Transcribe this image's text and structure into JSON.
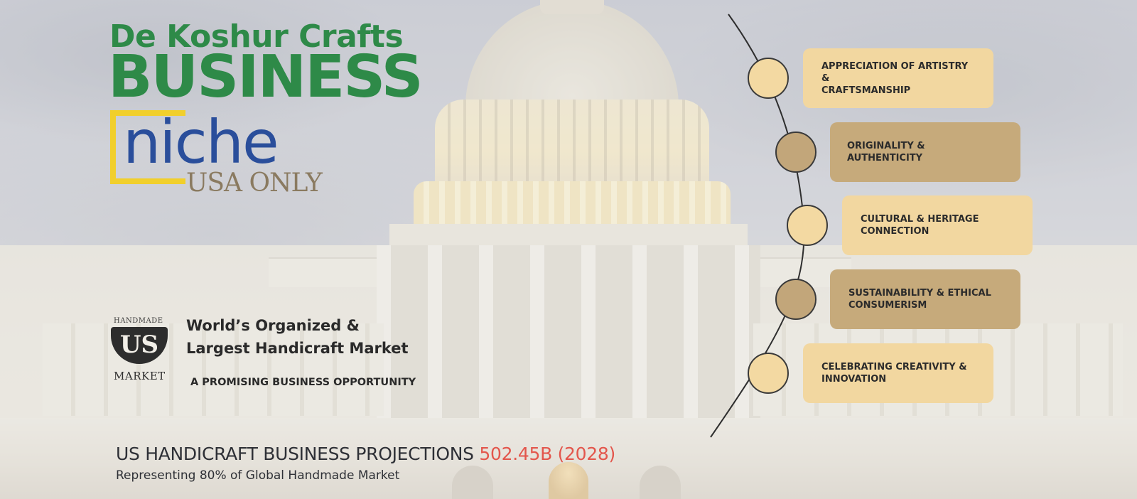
{
  "title": {
    "line1": "De Koshur Crafts",
    "line2": "BUSINESS",
    "niche": "niche",
    "region": "USA ONLY"
  },
  "market": {
    "logo_top": "HANDMADE",
    "logo_mark": "US",
    "logo_bottom": "MARKET",
    "heading_line1": "World’s Organized &",
    "heading_line2": "Largest Handicraft Market",
    "tagline": "A PROMISING BUSINESS OPPORTUNITY"
  },
  "projection": {
    "label": "US HANDICRAFT BUSINESS PROJECTIONS ",
    "value": "502.45B (2028)",
    "subtitle": "Representing 80% of Global Handmade Market"
  },
  "timeline": [
    {
      "line1": "APPRECIATION OF ARTISTRY &",
      "line2": "CRAFTSMANSHIP"
    },
    {
      "line1": "ORIGINALITY & AUTHENTICITY",
      "line2": ""
    },
    {
      "line1": "CULTURAL & HERITAGE",
      "line2": "CONNECTION"
    },
    {
      "line1": "SUSTAINABILITY & ETHICAL",
      "line2": "CONSUMERISM"
    },
    {
      "line1": "CELEBRATING CREATIVITY &",
      "line2": "INNOVATION"
    }
  ],
  "colors": {
    "title_green": "#2e8a48",
    "niche_blue": "#2a4e9b",
    "bracket_yellow": "#f1cf2c",
    "highlight_red": "#e3564c",
    "card_light": "#f2d7a0",
    "card_dark": "#c6aa7b"
  },
  "background": {
    "icon": "capitol-building-photo"
  }
}
